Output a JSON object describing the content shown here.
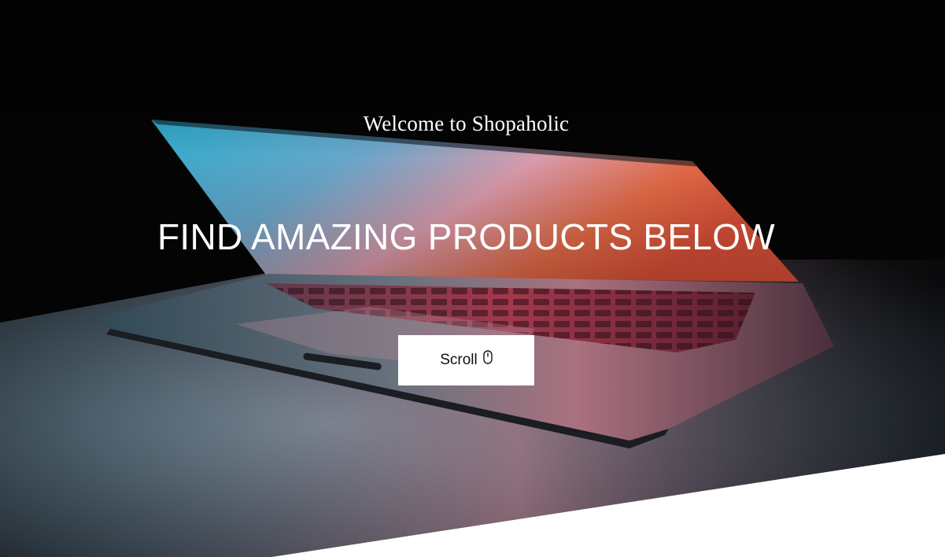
{
  "hero": {
    "welcome_text": "Welcome to Shopaholic",
    "headline": "FIND AMAZING PRODUCTS BELOW",
    "scroll_button": {
      "label": "Scroll",
      "icon": "mouse-icon"
    }
  },
  "colors": {
    "background": "#050505",
    "text": "#ffffff",
    "button_bg": "#ffffff",
    "button_text": "#111111"
  }
}
